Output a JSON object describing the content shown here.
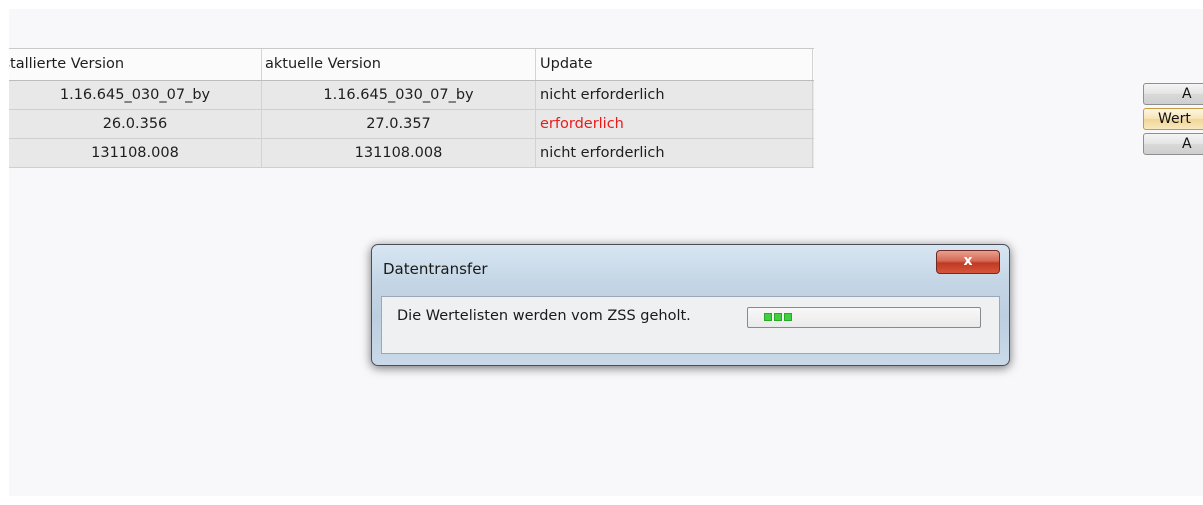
{
  "table": {
    "headers": [
      "Installierte Version",
      "aktuelle Version",
      "Update"
    ],
    "rows": [
      {
        "installed": "1.16.645_030_07_by",
        "current": "1.16.645_030_07_by",
        "update": "nicht erforderlich"
      },
      {
        "installed": "26.0.356",
        "current": "27.0.357",
        "update": "erforderlich"
      },
      {
        "installed": "131108.008",
        "current": "131108.008",
        "update": "nicht erforderlich"
      }
    ]
  },
  "side_buttons": [
    "A",
    "Wert",
    "A"
  ],
  "dialog": {
    "title": "Datentransfer",
    "close_label": "x",
    "message": "Die Wertelisten werden vom ZSS geholt.",
    "progress_segments": 3
  },
  "colors": {
    "update_required": "#ea1a1a",
    "progress": "#3fd13f"
  }
}
